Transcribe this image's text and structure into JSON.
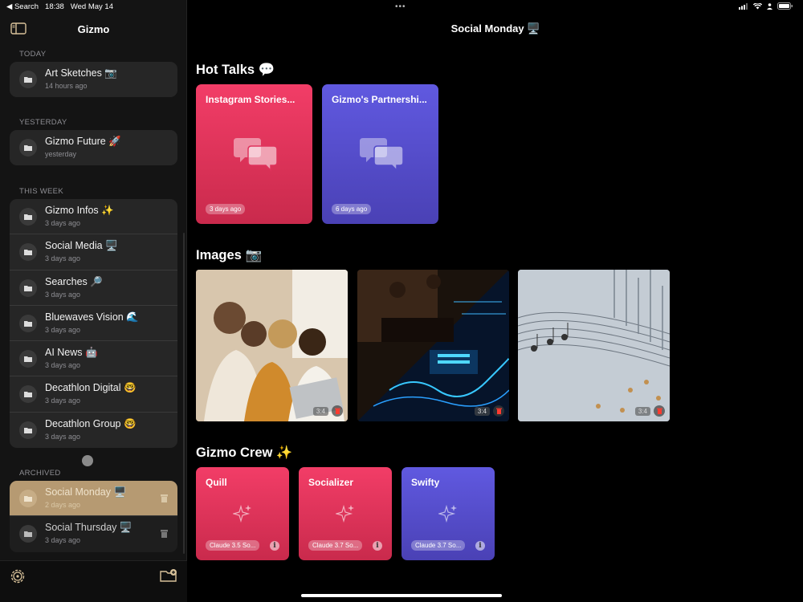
{
  "status_bar": {
    "back_label": "◀ Search",
    "time": "18:38",
    "date": "Wed May 14",
    "dots": "•••"
  },
  "sidebar": {
    "title": "Gizmo",
    "sections": [
      {
        "label": "TODAY",
        "items": [
          {
            "title": "Art Sketches 📷",
            "subtitle": "14 hours ago"
          }
        ]
      },
      {
        "label": "YESTERDAY",
        "items": [
          {
            "title": "Gizmo Future 🚀",
            "subtitle": "yesterday"
          }
        ]
      },
      {
        "label": "THIS WEEK",
        "items": [
          {
            "title": "Gizmo Infos ✨",
            "subtitle": "3 days ago"
          },
          {
            "title": "Social Media 🖥️",
            "subtitle": "3 days ago"
          },
          {
            "title": "Searches 🔎",
            "subtitle": "3 days ago"
          },
          {
            "title": "Bluewaves Vision 🌊",
            "subtitle": "3 days ago"
          },
          {
            "title": "AI News 🤖",
            "subtitle": "3 days ago"
          },
          {
            "title": "Decathlon Digital 🤓",
            "subtitle": "3 days ago"
          },
          {
            "title": "Decathlon Group 🤓",
            "subtitle": "3 days ago"
          }
        ]
      },
      {
        "label": "ARCHIVED",
        "items": [
          {
            "title": "Social Monday 🖥️",
            "subtitle": "2 days ago",
            "selected": true
          },
          {
            "title": "Social Thursday 🖥️",
            "subtitle": "3 days ago"
          }
        ]
      }
    ]
  },
  "main": {
    "title": "Social Monday 🖥️",
    "hot_talks": {
      "heading": "Hot Talks 💬",
      "cards": [
        {
          "title": "Instagram Stories...",
          "age": "3 days ago",
          "color": "#f23d67"
        },
        {
          "title": "Gizmo's Partnershi...",
          "age": "6 days ago",
          "color": "#5c55dc"
        }
      ]
    },
    "images": {
      "heading": "Images 📷",
      "items": [
        {
          "description": "people-laptop-photo",
          "ratio": "3:4"
        },
        {
          "description": "studio-soundwave-photo",
          "ratio": "3:4"
        },
        {
          "description": "circuit-music-photo",
          "ratio": "3:4"
        }
      ]
    },
    "crew": {
      "heading": "Gizmo Crew ✨",
      "members": [
        {
          "name": "Quill",
          "model": "Claude 3.5 So...",
          "color": "#f23d67"
        },
        {
          "name": "Socializer",
          "model": "Claude 3.7 So...",
          "color": "#f23d67"
        },
        {
          "name": "Swifty",
          "model": "Claude 3.7 So...",
          "color": "#5c55dc"
        }
      ]
    }
  },
  "icons": {
    "info": "i"
  }
}
